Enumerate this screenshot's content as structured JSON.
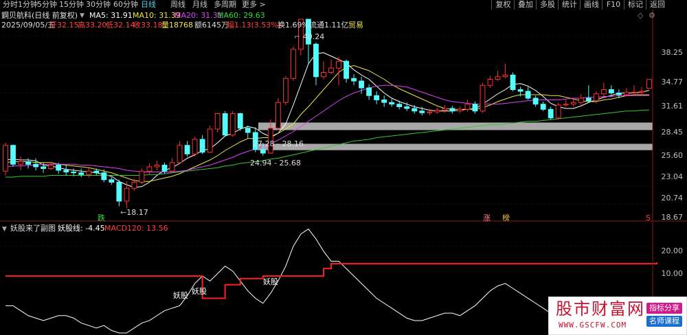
{
  "periods": [
    "分时",
    "1分钟",
    "5分钟",
    "15分钟",
    "30分钟",
    "60分钟",
    "日线",
    "周线",
    "月线",
    "多周期",
    "更多 >"
  ],
  "active_period": "日线",
  "right_buttons": [
    "复权",
    "叠加",
    "多股",
    "统计",
    "画线",
    "F10",
    "标记",
    "返回"
  ],
  "header": {
    "stock": "鋼贝航科(日线 前复权)",
    "ma": [
      {
        "label": "MA5: 31.91",
        "color": "#ffffff"
      },
      {
        "label": "MA10: 31.39",
        "color": "#f0e442"
      },
      {
        "label": "MA20: 31.31",
        "color": "#e040fb"
      },
      {
        "label": "MA60: 29.63",
        "color": "#33dd33"
      }
    ],
    "date": "2025/09/05/五",
    "open": "开32.15",
    "high": "高33.20",
    "low": "低32.14",
    "close": "收33.18",
    "volume": "量18768",
    "amount": "额6145万",
    "change": "幅1.13(3.53%)",
    "turnover": "换1.69%",
    "float_cap": "流通1.11亿",
    "sector": "贸易"
  },
  "annotations": {
    "peak": "40.24",
    "trough": "18.17",
    "zone1": "27.28 - 28.16",
    "zone2": "24.94 - 25.68",
    "die": "跌",
    "zhang": "涨",
    "bang": "榜"
  },
  "y_axis_main": [
    "38.25",
    "34.77",
    "31.61",
    "28.45",
    "25.60",
    "23.04",
    "20.74",
    "18.67"
  ],
  "indicator": {
    "title": "妖股来了副图",
    "yao_line": "妖股线: -4.45",
    "macd": "MACD120: 13.56",
    "marks": [
      "妖股",
      "妖股",
      "妖股"
    ]
  },
  "y_axis_sub": [
    "20.00",
    "10.00"
  ],
  "watermark": {
    "title": "股市财富网",
    "url": "WWW.GSCFW.COM",
    "tag1": "指标分享",
    "tag2": "名师课程"
  },
  "chart_data": {
    "type": "candlestick",
    "price_range": [
      17.0,
      41.0
    ],
    "candles": [
      [
        22.5,
        25.5,
        25.8,
        22.0
      ],
      [
        25.5,
        23.3,
        25.6,
        23.0
      ],
      [
        23.3,
        23.6,
        24.2,
        22.6
      ],
      [
        23.6,
        23.3,
        24.0,
        22.8
      ],
      [
        23.3,
        23.0,
        24.0,
        22.6
      ],
      [
        23.0,
        22.8,
        23.5,
        22.3
      ],
      [
        22.8,
        23.2,
        23.6,
        22.6
      ],
      [
        23.2,
        22.6,
        23.5,
        22.2
      ],
      [
        22.6,
        22.4,
        23.2,
        22.0
      ],
      [
        22.4,
        22.3,
        22.8,
        21.9
      ],
      [
        22.3,
        22.1,
        22.8,
        21.8
      ],
      [
        22.1,
        22.5,
        22.9,
        21.8
      ],
      [
        22.5,
        22.3,
        22.8,
        22.0
      ],
      [
        22.3,
        21.5,
        22.7,
        21.2
      ],
      [
        21.5,
        21.2,
        21.8,
        20.9
      ],
      [
        21.2,
        19.0,
        21.5,
        18.4
      ],
      [
        19.0,
        20.5,
        21.3,
        18.17
      ],
      [
        20.5,
        21.2,
        21.6,
        20.2
      ],
      [
        21.2,
        22.5,
        22.8,
        21.0
      ],
      [
        22.5,
        23.0,
        23.4,
        22.1
      ],
      [
        23.0,
        23.2,
        23.7,
        22.6
      ],
      [
        23.2,
        22.5,
        23.5,
        22.2
      ],
      [
        22.5,
        23.5,
        24.0,
        22.3
      ],
      [
        23.5,
        25.5,
        26.0,
        23.3
      ],
      [
        25.5,
        24.5,
        26.0,
        24.2
      ],
      [
        24.5,
        26.2,
        26.5,
        24.2
      ],
      [
        26.2,
        24.7,
        26.7,
        24.5
      ],
      [
        24.7,
        27.4,
        27.8,
        24.6
      ],
      [
        27.4,
        29.2,
        29.3,
        27.0
      ],
      [
        29.2,
        26.7,
        29.5,
        26.5
      ],
      [
        26.7,
        29.2,
        29.5,
        26.5
      ],
      [
        29.2,
        27.5,
        29.3,
        27.2
      ],
      [
        27.5,
        27.0,
        27.8,
        26.3
      ],
      [
        27.0,
        25.0,
        27.6,
        24.7
      ],
      [
        25.0,
        24.6,
        25.8,
        24.3
      ],
      [
        24.6,
        27.5,
        28.5,
        24.5
      ],
      [
        27.5,
        30.5,
        31.0,
        27.3
      ],
      [
        30.5,
        33.3,
        33.6,
        30.2
      ],
      [
        33.3,
        36.7,
        37.0,
        33.0
      ],
      [
        36.7,
        40.2,
        40.24,
        36.0
      ],
      [
        40.2,
        37.3,
        40.0,
        35.0
      ],
      [
        37.3,
        33.5,
        37.5,
        32.5
      ],
      [
        33.5,
        34.0,
        35.3,
        33.2
      ],
      [
        34.0,
        34.5,
        35.5,
        33.8
      ],
      [
        34.5,
        35.3,
        35.8,
        32.5
      ],
      [
        35.3,
        33.3,
        35.5,
        32.8
      ],
      [
        33.3,
        33.0,
        33.8,
        32.5
      ],
      [
        33.0,
        32.2,
        33.5,
        31.5
      ],
      [
        32.2,
        31.3,
        32.6,
        30.8
      ],
      [
        31.3,
        30.8,
        31.8,
        30.3
      ],
      [
        30.8,
        30.5,
        31.3,
        30.0
      ],
      [
        30.5,
        30.3,
        30.9,
        30.0
      ],
      [
        30.3,
        30.0,
        30.7,
        29.7
      ],
      [
        30.0,
        29.8,
        30.5,
        29.5
      ],
      [
        29.8,
        29.5,
        30.2,
        29.2
      ],
      [
        29.5,
        29.3,
        30.0,
        29.0
      ],
      [
        29.3,
        29.4,
        29.8,
        29.0
      ],
      [
        29.4,
        29.6,
        29.9,
        29.2
      ],
      [
        29.6,
        29.8,
        30.2,
        29.3
      ],
      [
        29.8,
        29.5,
        30.1,
        29.2
      ],
      [
        29.5,
        29.7,
        30.0,
        29.3
      ],
      [
        29.7,
        30.3,
        30.8,
        29.4
      ],
      [
        30.3,
        29.5,
        30.6,
        29.2
      ],
      [
        29.5,
        32.5,
        32.8,
        29.3
      ],
      [
        32.5,
        33.2,
        33.6,
        32.2
      ],
      [
        33.2,
        33.5,
        34.2,
        33.0
      ],
      [
        33.5,
        33.7,
        35.0,
        33.3
      ],
      [
        33.7,
        32.0,
        34.0,
        31.8
      ],
      [
        32.0,
        31.8,
        32.3,
        31.2
      ],
      [
        31.8,
        31.0,
        32.3,
        30.8
      ],
      [
        31.0,
        30.3,
        31.3,
        30.0
      ],
      [
        30.3,
        29.7,
        30.6,
        29.5
      ],
      [
        29.7,
        28.7,
        30.0,
        28.5
      ],
      [
        28.7,
        30.2,
        30.5,
        28.5
      ],
      [
        30.2,
        30.3,
        30.8,
        30.0
      ],
      [
        30.3,
        30.5,
        31.0,
        30.0
      ],
      [
        30.5,
        31.0,
        31.5,
        30.2
      ],
      [
        31.0,
        30.7,
        32.5,
        30.5
      ],
      [
        30.7,
        31.5,
        31.8,
        30.4
      ],
      [
        31.5,
        32.0,
        32.8,
        31.0
      ],
      [
        32.0,
        31.6,
        32.5,
        31.3
      ],
      [
        31.6,
        31.4,
        32.0,
        31.0
      ],
      [
        31.4,
        31.7,
        32.2,
        31.2
      ],
      [
        31.7,
        31.7,
        32.5,
        31.3
      ],
      [
        31.7,
        31.8,
        32.3,
        31.3
      ],
      [
        32.15,
        33.18,
        33.2,
        32.14
      ]
    ],
    "ma": {
      "MA5": [
        23.8,
        23.9,
        23.8,
        23.8,
        23.7,
        23.2,
        23.1,
        22.9,
        22.7,
        22.6,
        22.5,
        22.4,
        22.3,
        22.1,
        21.9,
        21.3,
        20.9,
        20.6,
        20.7,
        21.2,
        22.0,
        22.6,
        22.9,
        23.4,
        24.0,
        24.4,
        24.9,
        25.1,
        25.8,
        26.6,
        26.9,
        27.4,
        27.7,
        27.5,
        26.9,
        26.5,
        26.9,
        28.0,
        30.2,
        32.6,
        35.0,
        36.2,
        36.3,
        35.9,
        35.5,
        35.1,
        34.3,
        33.7,
        33.2,
        32.4,
        31.6,
        31.0,
        30.6,
        30.3,
        30.0,
        29.8,
        29.6,
        29.5,
        29.5,
        29.5,
        29.6,
        29.7,
        29.8,
        30.3,
        30.9,
        31.5,
        32.0,
        32.6,
        32.7,
        32.4,
        31.9,
        31.2,
        30.4,
        30.0,
        29.8,
        29.8,
        30.1,
        30.5,
        30.8,
        31.1,
        31.3,
        31.6,
        31.6,
        31.6,
        31.7,
        31.91
      ],
      "MA10": [
        23.5,
        23.6,
        23.6,
        23.6,
        23.5,
        23.5,
        23.5,
        23.3,
        23.2,
        23.1,
        23.0,
        22.9,
        22.7,
        22.5,
        22.3,
        22.0,
        21.7,
        21.4,
        21.3,
        21.3,
        21.5,
        21.7,
        21.9,
        22.2,
        22.6,
        23.0,
        23.4,
        23.8,
        24.3,
        24.9,
        25.4,
        25.9,
        26.3,
        26.3,
        26.4,
        26.4,
        26.9,
        27.4,
        28.0,
        29.1,
        30.0,
        31.0,
        32.0,
        33.0,
        34.0,
        34.6,
        34.8,
        34.5,
        34.2,
        33.7,
        33.2,
        32.6,
        32.1,
        31.7,
        31.3,
        30.9,
        30.5,
        30.1,
        29.8,
        29.7,
        29.7,
        29.7,
        29.7,
        29.9,
        30.2,
        30.6,
        30.9,
        31.2,
        31.4,
        31.4,
        31.4,
        31.4,
        31.3,
        31.3,
        31.1,
        30.9,
        30.7,
        30.6,
        30.6,
        30.8,
        30.9,
        31.1,
        31.3,
        31.4,
        31.4,
        31.39
      ],
      "MA20": [
        23.0,
        23.1,
        23.1,
        23.2,
        23.2,
        23.3,
        23.3,
        23.3,
        23.3,
        23.3,
        23.2,
        23.2,
        23.1,
        23.0,
        22.9,
        22.8,
        22.6,
        22.5,
        22.4,
        22.4,
        22.4,
        22.4,
        22.4,
        22.5,
        22.6,
        22.8,
        23.0,
        23.2,
        23.5,
        23.8,
        24.1,
        24.5,
        24.8,
        25.1,
        25.4,
        25.7,
        26.1,
        26.6,
        27.1,
        27.7,
        28.3,
        28.9,
        29.5,
        30.1,
        30.7,
        31.2,
        31.6,
        31.9,
        32.2,
        32.4,
        32.5,
        32.5,
        32.4,
        32.3,
        32.0,
        31.7,
        31.4,
        31.1,
        30.8,
        30.6,
        30.5,
        30.4,
        30.3,
        30.3,
        30.3,
        30.3,
        30.4,
        30.5,
        30.6,
        30.7,
        30.8,
        30.8,
        30.8,
        30.8,
        30.9,
        31.0,
        31.0,
        31.1,
        31.1,
        31.2,
        31.2,
        31.3,
        31.3,
        31.3,
        31.3,
        31.31
      ],
      "MA60": [
        21.8,
        21.8,
        21.9,
        21.9,
        21.9,
        21.9,
        22.0,
        22.0,
        22.0,
        22.0,
        22.0,
        22.0,
        22.0,
        22.0,
        22.0,
        22.0,
        22.0,
        22.0,
        22.0,
        22.1,
        22.1,
        22.2,
        22.3,
        22.4,
        22.5,
        22.6,
        22.7,
        22.8,
        22.9,
        23.1,
        23.2,
        23.4,
        23.5,
        23.6,
        23.7,
        23.9,
        24.0,
        24.2,
        24.4,
        24.6,
        24.8,
        25.0,
        25.2,
        25.4,
        25.6,
        25.8,
        26.0,
        26.1,
        26.2,
        26.4,
        26.5,
        26.6,
        26.7,
        26.8,
        26.9,
        27.0,
        27.1,
        27.2,
        27.3,
        27.4,
        27.5,
        27.6,
        27.7,
        27.8,
        27.9,
        27.9,
        28.0,
        28.1,
        28.2,
        28.3,
        28.3,
        28.4,
        28.5,
        28.6,
        28.7,
        28.8,
        28.9,
        29.0,
        29.1,
        29.2,
        29.3,
        29.4,
        29.5,
        29.5,
        29.6,
        29.63
      ]
    },
    "sub": {
      "range": [
        -15,
        28
      ],
      "yao": [
        -4,
        -4,
        -6,
        -8,
        -9,
        -10,
        -9,
        -8,
        -8,
        -9,
        -11,
        -12,
        -13,
        -12,
        -14,
        -15,
        -15,
        -13,
        -11,
        -10,
        -8,
        -6,
        -5,
        -4,
        0,
        5,
        8,
        6,
        9,
        12,
        10,
        6,
        2,
        -1,
        -3,
        1,
        6,
        12,
        20,
        25,
        27,
        23,
        18,
        14,
        14,
        11,
        8,
        5,
        2,
        -1,
        -3,
        -5,
        -7,
        -9,
        -10,
        -10,
        -9,
        -8,
        -7,
        -7,
        -8,
        -6,
        -4,
        -1,
        2,
        4,
        5,
        3,
        1,
        -1,
        -3,
        -5,
        -7,
        -8,
        -8,
        -7,
        -6,
        -5,
        -5,
        -4,
        -4,
        -5,
        -6,
        -5,
        -4,
        -4.45
      ],
      "macd": [
        8,
        8,
        8,
        8,
        8,
        8,
        8,
        8,
        8,
        8,
        8,
        8,
        8,
        8,
        8,
        8,
        8,
        8,
        8,
        8,
        8,
        8,
        8,
        8,
        8,
        8,
        -1,
        -1,
        -1,
        4.5,
        4.5,
        7,
        7,
        7,
        8,
        8,
        8,
        8,
        8,
        8,
        8,
        8,
        11,
        13,
        13,
        13,
        13,
        13,
        13,
        13,
        13,
        13,
        13,
        13,
        13,
        13,
        13,
        13,
        13,
        13,
        13,
        13,
        13,
        13,
        13,
        13,
        13,
        13,
        13,
        13,
        13,
        13,
        13,
        13,
        13,
        13,
        13,
        13,
        13,
        13,
        13,
        13,
        13,
        13,
        13,
        13,
        13.56
      ]
    },
    "zones": [
      [
        27.28,
        28.16
      ],
      [
        24.94,
        25.68
      ]
    ]
  }
}
